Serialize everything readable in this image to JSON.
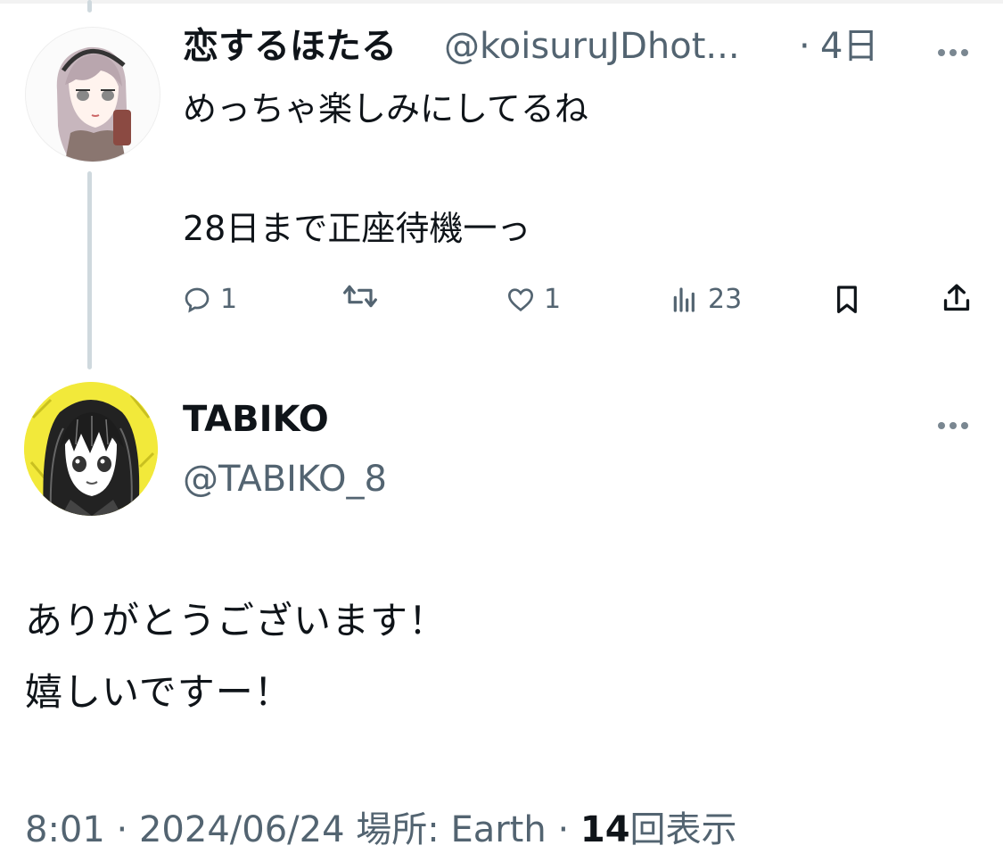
{
  "reply": {
    "display_name": "恋するほたる",
    "handle": "@koisuruJDhot...",
    "separator": "·",
    "time": "4日",
    "text_line1": "めっちゃ楽しみにしてるね",
    "text_line2": "28日まで正座待機一っ",
    "actions": {
      "reply_count": "1",
      "retweet_count": "",
      "like_count": "1",
      "views_count": "23"
    },
    "icons": [
      "reply-icon",
      "retweet-icon",
      "like-icon",
      "views-icon",
      "bookmark-icon",
      "share-icon",
      "more-icon"
    ]
  },
  "main": {
    "display_name": "TABIKO",
    "handle": "@TABIKO_8",
    "text_line1": "ありがとうございます！",
    "text_line2": "嬉しいですー！",
    "meta": {
      "time": "8:01",
      "sep1": "·",
      "date": "2024/06/24",
      "location_label": "場所: Earth",
      "sep2": "·",
      "views": "14",
      "views_label": "回表示"
    }
  },
  "colors": {
    "text": "#0f1419",
    "secondary": "#536471",
    "thread_line": "#cfd9de",
    "avatar_yellow": "#f2e93a"
  }
}
